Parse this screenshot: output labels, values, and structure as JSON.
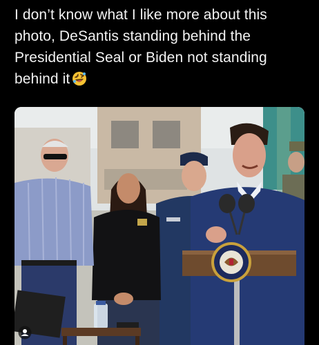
{
  "post": {
    "caption_lines": [
      "I don’t know what I like more about this",
      "photo, DeSantis standing behind the",
      "Presidential Seal or Biden not standing",
      "behind it"
    ],
    "caption_emoji": "rolling-on-floor-laughing-emoji"
  },
  "photo": {
    "subject": "press-event-photo",
    "podium_seal": "presidential-seal",
    "user_tag_icon": "person-tag-icon"
  },
  "colors": {
    "background": "#000000",
    "caption_text": "#f2f2f2"
  }
}
